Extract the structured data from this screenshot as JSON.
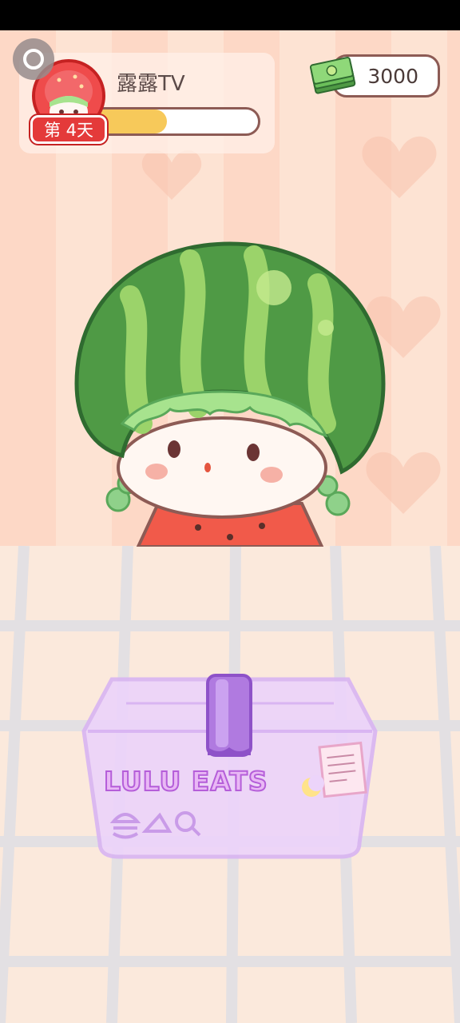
{
  "profile": {
    "channel_name": "露露TV",
    "day_label": "第 4天",
    "progress_fraction": 0.45
  },
  "currency": {
    "amount": "3000",
    "icon": "cash-stack-icon"
  },
  "lunchbox": {
    "label": "LULU EATS"
  },
  "colors": {
    "accent_red": "#e43a3a",
    "progress_fill": "#f7c95a",
    "outline_brown": "#8d5b55",
    "lunchbox_purple": "#c99be8"
  }
}
